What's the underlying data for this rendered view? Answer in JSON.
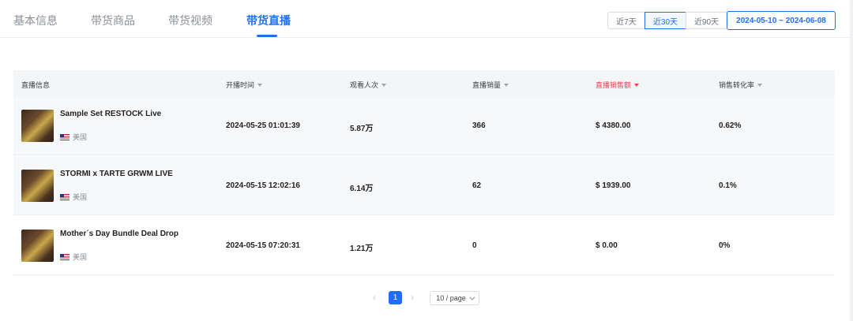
{
  "tabs": [
    {
      "label": "基本信息",
      "active": false
    },
    {
      "label": "带货商品",
      "active": false
    },
    {
      "label": "带货视频",
      "active": false
    },
    {
      "label": "带货直播",
      "active": true
    }
  ],
  "range": {
    "options": [
      "近7天",
      "近30天",
      "近90天"
    ],
    "selected": "近30天",
    "date_range": "2024-05-10 ~ 2024-06-08"
  },
  "table": {
    "columns": [
      "直播信息",
      "开播时间",
      "观看人次",
      "直播销量",
      "直播销售额",
      "销售转化率"
    ],
    "sorted_column": "直播销售额",
    "rows": [
      {
        "title": "Sample Set RESTOCK Live",
        "region": "美国",
        "start_time": "2024-05-25 01:01:39",
        "viewers": "5.87万",
        "sales_volume": "366",
        "sales_amount": "$ 4380.00",
        "conversion": "0.62%"
      },
      {
        "title": "STORMI x TARTE GRWM LIVE",
        "region": "美国",
        "start_time": "2024-05-15 12:02:16",
        "viewers": "6.14万",
        "sales_volume": "62",
        "sales_amount": "$ 1939.00",
        "conversion": "0.1%"
      },
      {
        "title": "Mother´s Day Bundle Deal Drop",
        "region": "美国",
        "start_time": "2024-05-15 07:20:31",
        "viewers": "1.21万",
        "sales_volume": "0",
        "sales_amount": "$ 0.00",
        "conversion": "0%"
      }
    ]
  },
  "pagination": {
    "prev": "‹",
    "next": "›",
    "current_page": "1",
    "page_size": "10 / page"
  },
  "colors": {
    "accent": "#1f6ff2",
    "sorted_header": "#f23d4f",
    "header_bg": "#f4f5f7"
  }
}
